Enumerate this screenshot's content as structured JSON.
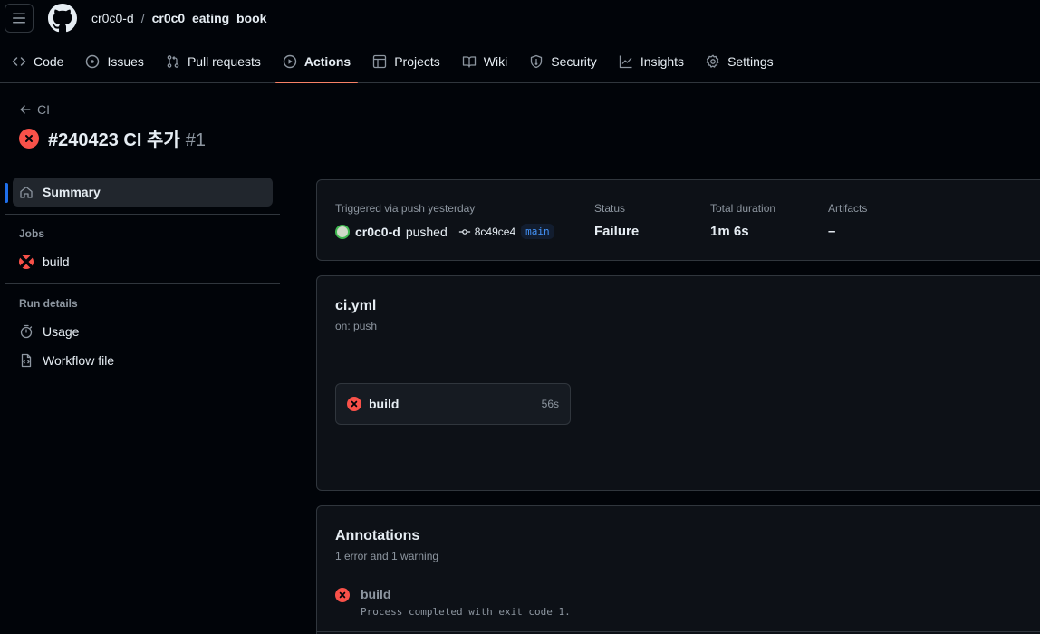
{
  "header": {
    "owner": "cr0c0-d",
    "separator": "/",
    "repo": "cr0c0_eating_book"
  },
  "tabs": [
    {
      "label": "Code",
      "icon": "code-icon"
    },
    {
      "label": "Issues",
      "icon": "issue-opened-icon"
    },
    {
      "label": "Pull requests",
      "icon": "git-pull-request-icon"
    },
    {
      "label": "Actions",
      "icon": "play-icon",
      "active": true
    },
    {
      "label": "Projects",
      "icon": "table-icon"
    },
    {
      "label": "Wiki",
      "icon": "book-icon"
    },
    {
      "label": "Security",
      "icon": "shield-icon"
    },
    {
      "label": "Insights",
      "icon": "graph-icon"
    },
    {
      "label": "Settings",
      "icon": "gear-icon"
    }
  ],
  "run": {
    "back_label": "CI",
    "title": "#240423 CI 추가",
    "number": "#1",
    "status_icon": "x-circle-icon"
  },
  "sidebar": {
    "summary_label": "Summary",
    "jobs_heading": "Jobs",
    "jobs": [
      {
        "label": "build",
        "status": "failure"
      }
    ],
    "run_details_heading": "Run details",
    "usage_label": "Usage",
    "workflow_file_label": "Workflow file"
  },
  "summary": {
    "trigger_label": "Triggered via push yesterday",
    "actor": "cr0c0-d",
    "action": "pushed",
    "commit": "8c49ce4",
    "branch": "main",
    "status_label": "Status",
    "status_value": "Failure",
    "duration_label": "Total duration",
    "duration_value": "1m 6s",
    "artifacts_label": "Artifacts",
    "artifacts_value": "–"
  },
  "workflow": {
    "file": "ci.yml",
    "on": "on: push",
    "job_name": "build",
    "job_duration": "56s"
  },
  "annotations": {
    "title": "Annotations",
    "subtitle": "1 error and 1 warning",
    "items": [
      {
        "job": "build",
        "message": "Process completed with exit code 1."
      }
    ]
  },
  "colors": {
    "background": "#010409",
    "accent_tab": "#f78166",
    "failure": "#f85149",
    "link": "#4493f8"
  }
}
